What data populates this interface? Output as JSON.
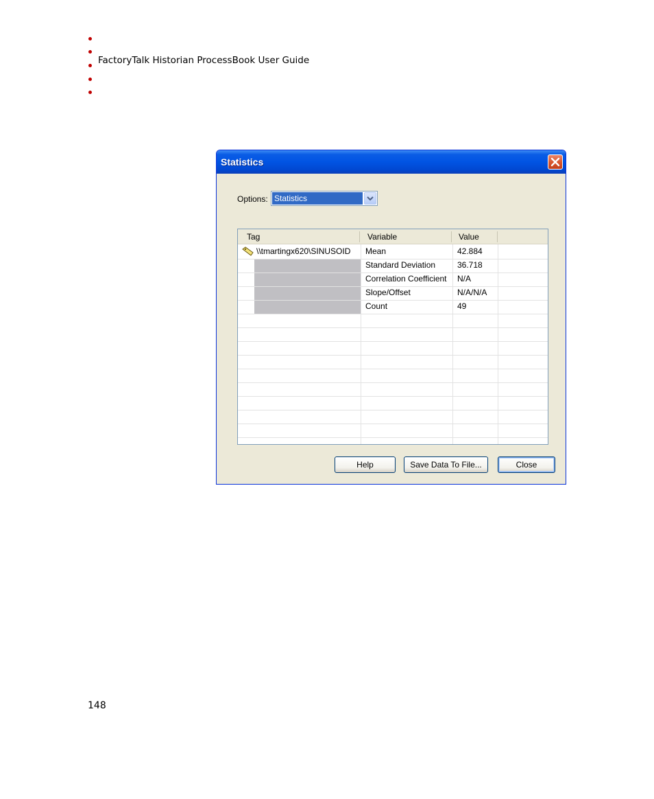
{
  "document": {
    "header_title": "FactoryTalk Historian ProcessBook User Guide",
    "page_number": "148",
    "bullet_color": "#c00000"
  },
  "dialog": {
    "title": "Statistics",
    "close_icon": "close-icon",
    "options_label": "Options:",
    "options_selected": "Statistics",
    "table": {
      "columns": [
        "Tag",
        "Variable",
        "Value"
      ],
      "tag_icon": "tag-icon",
      "tag": "\\\\tmartingx620\\SINUSOID",
      "rows": [
        {
          "variable": "Mean",
          "value": "42.884"
        },
        {
          "variable": "Standard Deviation",
          "value": "36.718"
        },
        {
          "variable": "Correlation Coefficient",
          "value": "N/A"
        },
        {
          "variable": "Slope/Offset",
          "value": "N/A/N/A"
        },
        {
          "variable": "Count",
          "value": "49"
        }
      ]
    },
    "buttons": {
      "help": "Help",
      "save": "Save Data To File...",
      "close": "Close"
    },
    "colors": {
      "titlebar": "#0154e3",
      "selection": "#316ac5",
      "face": "#ece9d8"
    }
  }
}
